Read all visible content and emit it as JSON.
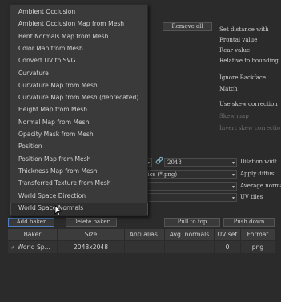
{
  "menu": {
    "items": [
      "Ambient Occlusion",
      "Ambient Occlusion Map from Mesh",
      "Bent Normals Map from Mesh",
      "Color Map from Mesh",
      "Convert UV to SVG",
      "Curvature",
      "Curvature Map from Mesh",
      "Curvature Map from Mesh (deprecated)",
      "Height Map from Mesh",
      "Normal Map from Mesh",
      "Opacity Mask from Mesh",
      "Position",
      "Position Map from Mesh",
      "Thickness Map from Mesh",
      "Transferred Texture from Mesh",
      "World Space Direction",
      "World Space Normals"
    ],
    "highlighted_index": 16
  },
  "right_panel": {
    "remove_all": "Remove all",
    "labels": [
      "Set distance with",
      "Frontal value",
      "Rear value",
      "Relative to bounding",
      "Ignore Backface",
      "Match",
      "Use skew correction",
      "Skew map",
      "Invert skew correctio"
    ],
    "dim_from_index": 7
  },
  "settings": {
    "size_value": "2048",
    "format_value": "hics (*.png)",
    "right_labels": [
      "Dilation widt",
      "Apply diffusi",
      "Average norma",
      "UV tiles"
    ]
  },
  "buttons": {
    "add_baker": "Add baker",
    "delete_baker": "Delete baker",
    "pull_to_top": "Pull to top",
    "push_down": "Push down"
  },
  "table": {
    "headers": [
      "Baker",
      "Size",
      "Anti alias.",
      "Avg. normals",
      "UV set",
      "Format"
    ],
    "rows": [
      {
        "check": "✓",
        "baker": "World Sp...",
        "size": "2048x2048",
        "anti_alias": "",
        "avg_normals": "",
        "uv_set": "0",
        "format": "png"
      }
    ]
  }
}
